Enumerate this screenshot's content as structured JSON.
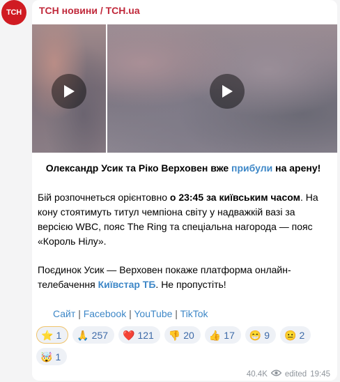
{
  "avatar_text": "ТСН",
  "channel_name": "ТСН новини / TCH.ua",
  "headline": {
    "pre": "Олександр Усик та Ріко Верховен вже ",
    "link": "прибули",
    "post": " на арену!"
  },
  "paragraph1": {
    "a": "Бій розпочнеться орієнтовно ",
    "b": "о 23:45 за київським часом",
    "c": ". На кону стоятимуть титул чемпіона світу у надважкій вазі за версією WBC, пояс The Ring та спеціальна нагорода — пояс «Король Нілу»."
  },
  "paragraph2": {
    "a": "Поєдинок Усик — Верховен покаже платформа онлайн-телебачення ",
    "b": "Київстар ТБ",
    "c": ". Не пропустіть!"
  },
  "links": [
    "Сайт",
    "Facebook",
    "YouTube",
    "TikTok"
  ],
  "reactions": [
    {
      "emoji": "⭐",
      "count": "1"
    },
    {
      "emoji": "🙏",
      "count": "257"
    },
    {
      "emoji": "❤️",
      "count": "121"
    },
    {
      "emoji": "👎",
      "count": "20"
    },
    {
      "emoji": "👍",
      "count": "17"
    },
    {
      "emoji": "😁",
      "count": "9"
    },
    {
      "emoji": "😐",
      "count": "2"
    },
    {
      "emoji": "🤯",
      "count": "1"
    }
  ],
  "footer": {
    "views": "40.4K",
    "edited": "edited",
    "time": "19:45"
  }
}
